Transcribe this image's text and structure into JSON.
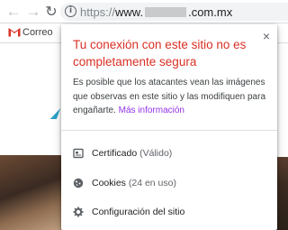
{
  "browser": {
    "url_scheme": "https://",
    "url_host_prefix": "www.",
    "url_host_suffix": ".com.mx"
  },
  "bookmarks": {
    "items": [
      {
        "label": "Correo",
        "icon": "gmail-icon"
      }
    ]
  },
  "popup": {
    "title": "Tu conexión con este sitio no es completamente segura",
    "description": "Es posible que los atacantes vean las imágenes que observas en este sitio y las modifiquen para engañarte.",
    "more_info_link": "Más información",
    "close_label": "×",
    "rows": [
      {
        "label": "Certificado",
        "sub": "(Válido)",
        "icon": "certificate-icon"
      },
      {
        "label": "Cookies",
        "sub": "(24 en uso)",
        "icon": "cookie-icon"
      },
      {
        "label": "Configuración del sitio",
        "sub": "",
        "icon": "gear-icon"
      }
    ]
  },
  "colors": {
    "warning_title": "#d93025",
    "link": "#9334e6"
  }
}
